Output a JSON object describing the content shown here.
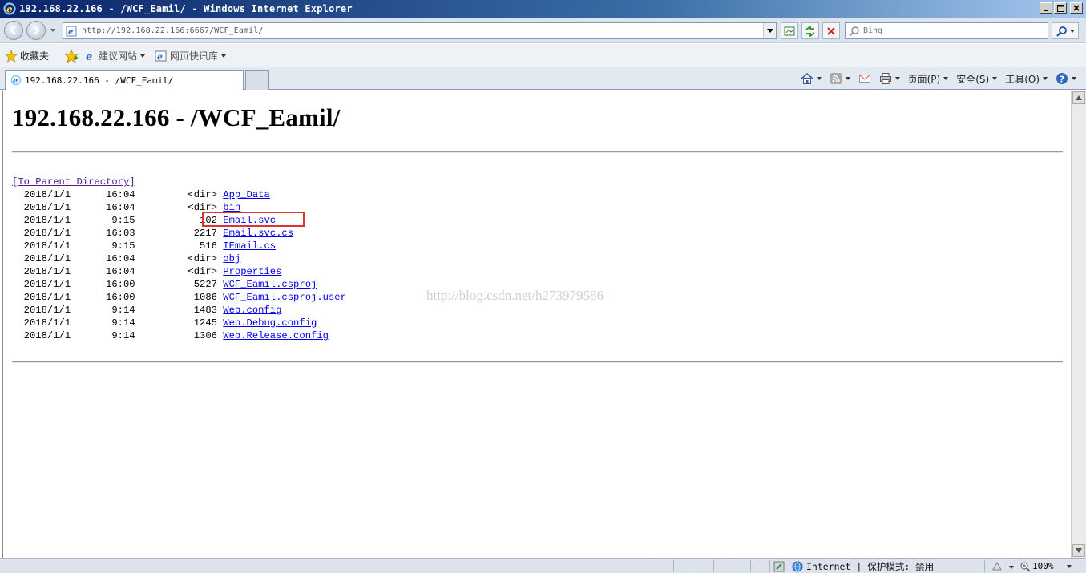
{
  "window": {
    "title": "192.168.22.166 - /WCF_Eamil/ - Windows Internet Explorer"
  },
  "address": {
    "url": "http://192.168.22.166:6667/WCF_Eamil/"
  },
  "search": {
    "placeholder": "Bing"
  },
  "favorites": {
    "label": "收藏夹",
    "items": [
      {
        "label": "建议网站"
      },
      {
        "label": "网页快讯库"
      }
    ]
  },
  "tab": {
    "label": "192.168.22.166 - /WCF_Eamil/"
  },
  "commands": {
    "page": "页面(P)",
    "safety": "安全(S)",
    "tools": "工具(O)"
  },
  "page": {
    "title": "192.168.22.166 - /WCF_Eamil/",
    "parent_link": "[To Parent Directory]",
    "entries": [
      {
        "date": "2018/1/1",
        "time": "16:04",
        "size": "<dir>",
        "name": "App_Data"
      },
      {
        "date": "2018/1/1",
        "time": "16:04",
        "size": "<dir>",
        "name": "bin"
      },
      {
        "date": "2018/1/1",
        "time": "9:15",
        "size": "102",
        "name": "Email.svc"
      },
      {
        "date": "2018/1/1",
        "time": "16:03",
        "size": "2217",
        "name": "Email.svc.cs"
      },
      {
        "date": "2018/1/1",
        "time": "9:15",
        "size": "516",
        "name": "IEmail.cs"
      },
      {
        "date": "2018/1/1",
        "time": "16:04",
        "size": "<dir>",
        "name": "obj"
      },
      {
        "date": "2018/1/1",
        "time": "16:04",
        "size": "<dir>",
        "name": "Properties"
      },
      {
        "date": "2018/1/1",
        "time": "16:00",
        "size": "5227",
        "name": "WCF_Eamil.csproj"
      },
      {
        "date": "2018/1/1",
        "time": "16:00",
        "size": "1086",
        "name": "WCF_Eamil.csproj.user"
      },
      {
        "date": "2018/1/1",
        "time": "9:14",
        "size": "1483",
        "name": "Web.config"
      },
      {
        "date": "2018/1/1",
        "time": "9:14",
        "size": "1245",
        "name": "Web.Debug.config"
      },
      {
        "date": "2018/1/1",
        "time": "9:14",
        "size": "1306",
        "name": "Web.Release.config"
      }
    ],
    "watermark": "http://blog.csdn.net/h273979586"
  },
  "status": {
    "zone": "Internet",
    "protected_mode": "保护模式: 禁用",
    "zoom": "100%"
  }
}
